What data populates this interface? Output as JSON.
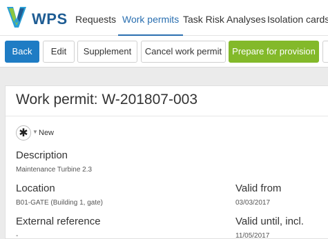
{
  "app": {
    "logo_text": "WPS"
  },
  "nav": {
    "items": [
      {
        "label": "Requests"
      },
      {
        "label": "Work permits",
        "active": true
      },
      {
        "label": "Task Risk Analyses"
      },
      {
        "label": "Isolation cards"
      }
    ]
  },
  "toolbar": {
    "back_label": "Back",
    "edit_label": "Edit",
    "supplement_label": "Supplement",
    "cancel_label": "Cancel work permit",
    "prepare_label": "Prepare for provision"
  },
  "permit": {
    "title": "Work permit: W-201807-003",
    "status": "New",
    "status_icon_glyph": "✱",
    "description_label": "Description",
    "description_value": "Maintenance Turbine 2.3",
    "location_label": "Location",
    "location_value": "B01-GATE (Building 1, gate)",
    "external_ref_label": "External reference",
    "external_ref_value": "-",
    "valid_from_label": "Valid from",
    "valid_from_value": "03/03/2017",
    "valid_until_label": "Valid until, incl.",
    "valid_until_value": "11/05/2017"
  },
  "colors": {
    "brand_blue": "#1f5d94",
    "nav_active": "#2a6fb0",
    "primary_button": "#1f7cc4",
    "success_button": "#83b92a",
    "logo_green": "#8cc63f",
    "logo_teal": "#2a9fd6"
  },
  "icons": {
    "logo": "wps-shield-icon",
    "status": "asterisk-status-icon",
    "caret": "caret-down-icon"
  }
}
